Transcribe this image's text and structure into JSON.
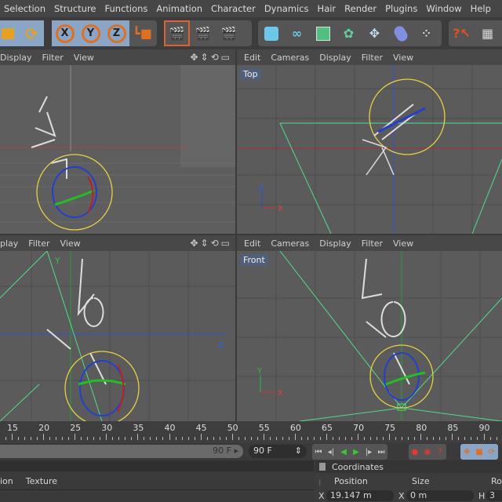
{
  "menu": [
    "Selection",
    "Structure",
    "Functions",
    "Animation",
    "Character",
    "Dynamics",
    "Hair",
    "Render",
    "Plugins",
    "Window",
    "Help"
  ],
  "toolbar": {
    "axis_x": "X",
    "axis_y": "Y",
    "axis_z": "Z"
  },
  "viewports": [
    {
      "menu": [
        "Display",
        "Filter",
        "View"
      ],
      "label": ""
    },
    {
      "menu": [
        "Edit",
        "Cameras",
        "Display",
        "Filter",
        "View"
      ],
      "label": "Top"
    },
    {
      "menu": [
        "play",
        "Filter",
        "View"
      ],
      "label": ""
    },
    {
      "menu": [
        "Edit",
        "Cameras",
        "Display",
        "Filter",
        "View"
      ],
      "label": "Front"
    }
  ],
  "axes": {
    "x": "X",
    "y": "Y",
    "z": "Z"
  },
  "timeline": {
    "ticks": [
      "15",
      "20",
      "25",
      "30",
      "35",
      "40",
      "45",
      "50",
      "55",
      "60",
      "65",
      "70",
      "75",
      "80",
      "85",
      "90"
    ],
    "end_frame": "90 F",
    "max_frame": "90 F"
  },
  "bottom": {
    "tabs": [
      "ion",
      "Texture"
    ],
    "coords_title": "Coordinates",
    "col_position": "Position",
    "col_size": "Size",
    "col_rot": "Rot",
    "pos_x_label": "X",
    "pos_x": "19.147 m",
    "size_x_label": "X",
    "size_x": "0 m",
    "rot_h_label": "H",
    "rot_h": "3"
  },
  "colors": {
    "accent": "#e07020",
    "selected": "#8aa6c6",
    "grid_green": "#4fdc8a",
    "gizmo_yellow": "#e8d040"
  }
}
